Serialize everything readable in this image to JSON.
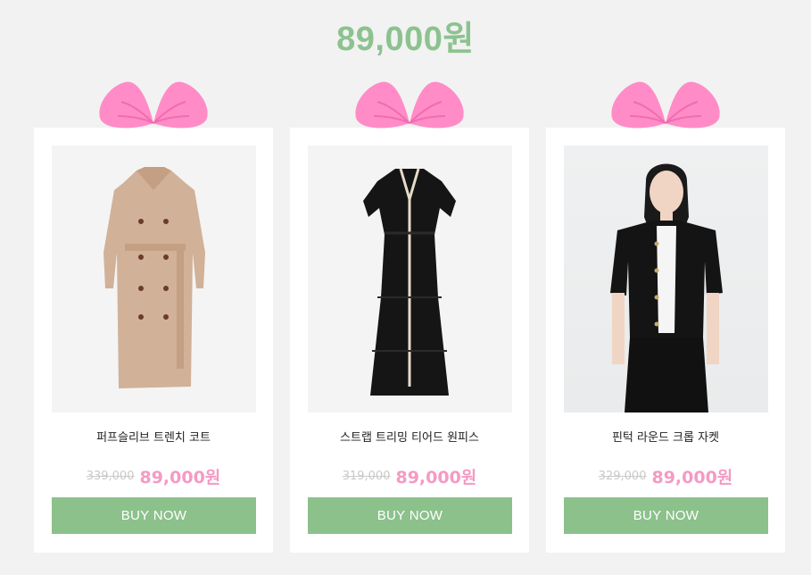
{
  "headline": "89,000원",
  "colors": {
    "accent_green": "#8cc18c",
    "sale_pink": "#f59ac4",
    "bow_pink": "#ff8cc6"
  },
  "products": [
    {
      "name": "퍼프슬리브 트렌치 코트",
      "original_price": "339,000",
      "sale_price": "89,000원",
      "button": "BUY NOW",
      "image": "beige-trench-coat"
    },
    {
      "name": "스트랩 트리밍 티어드 원피스",
      "original_price": "319,000",
      "sale_price": "89,000원",
      "button": "BUY NOW",
      "image": "black-tiered-dress"
    },
    {
      "name": "핀턱 라운드 크롭 자켓",
      "original_price": "329,000",
      "sale_price": "89,000원",
      "button": "BUY NOW",
      "image": "model-black-crop-jacket"
    }
  ]
}
